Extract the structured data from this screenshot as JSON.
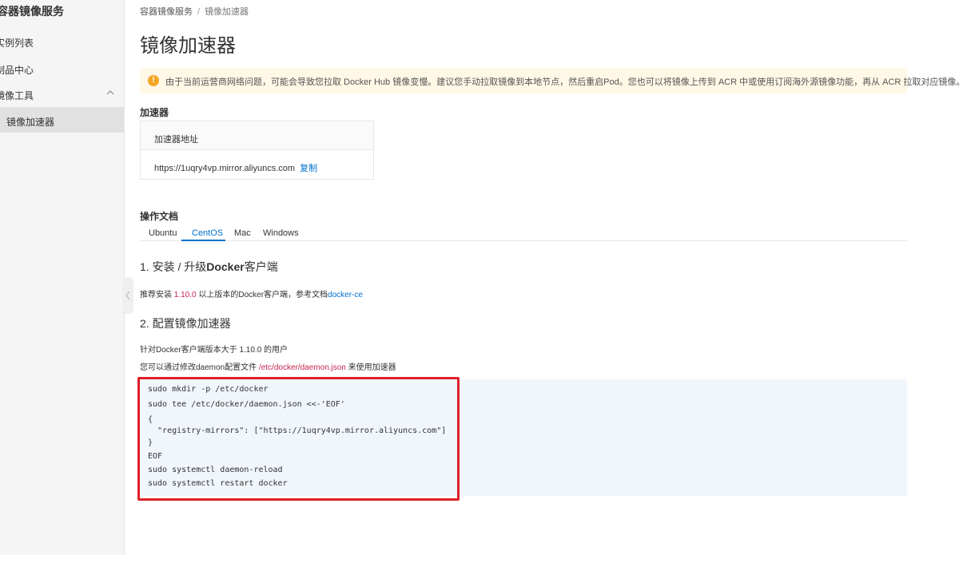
{
  "sidebar": {
    "title": "容器镜像服务",
    "items": [
      {
        "label": "实例列表"
      },
      {
        "label": "制品中心"
      },
      {
        "label": "镜像工具"
      }
    ],
    "active_item": "镜像加速器"
  },
  "breadcrumb": {
    "root": "容器镜像服务",
    "separator": "/",
    "current": "镜像加速器"
  },
  "page_title": "镜像加速器",
  "notice": {
    "icon": "!",
    "text": "由于当前运营商网络问题，可能会导致您拉取 Docker Hub 镜像变慢。建议您手动拉取镜像到本地节点，然后重启Pod。您也可以将镜像上传到 ACR 中或使用订阅海外源镜像功能，再从 ACR 拉取对应镜像。"
  },
  "accelerator": {
    "section_label": "加速器",
    "header": "加速器地址",
    "url": "https://1uqry4vp.mirror.aliyuncs.com",
    "copy_label": "复制"
  },
  "docs": {
    "section_label": "操作文档",
    "tabs": [
      {
        "label": "Ubuntu"
      },
      {
        "label": "CentOS"
      },
      {
        "label": "Mac"
      },
      {
        "label": "Windows"
      }
    ],
    "active_tab": "CentOS"
  },
  "step1": {
    "title_prefix": "1. 安装 / 升级",
    "title_bold": "Docker",
    "title_suffix": "客户端",
    "text_prefix": "推荐安装 ",
    "version": "1.10.0",
    "text_mid": " 以上版本的Docker客户端，参考文档",
    "doc_link": "docker-ce"
  },
  "step2": {
    "title": "2. 配置镜像加速器",
    "line1": "针对Docker客户端版本大于 1.10.0 的用户",
    "line2_prefix": "您可以通过修改daemon配置文件 ",
    "path": "/etc/docker/daemon.json",
    "line2_suffix": " 来使用加速器"
  },
  "code": [
    "sudo mkdir -p /etc/docker",
    "sudo tee /etc/docker/daemon.json <<-'EOF'",
    "{",
    "  \"registry-mirrors\": [\"https://1uqry4vp.mirror.aliyuncs.com\"]",
    "}",
    "EOF",
    "sudo systemctl daemon-reload",
    "sudo systemctl restart docker"
  ],
  "colors": {
    "accent": "#0070cc",
    "highlight_border": "#e0202a",
    "notice_bg": "#fff8e6",
    "code_bg": "#f0f6fc",
    "code_red": "#c7254e"
  }
}
